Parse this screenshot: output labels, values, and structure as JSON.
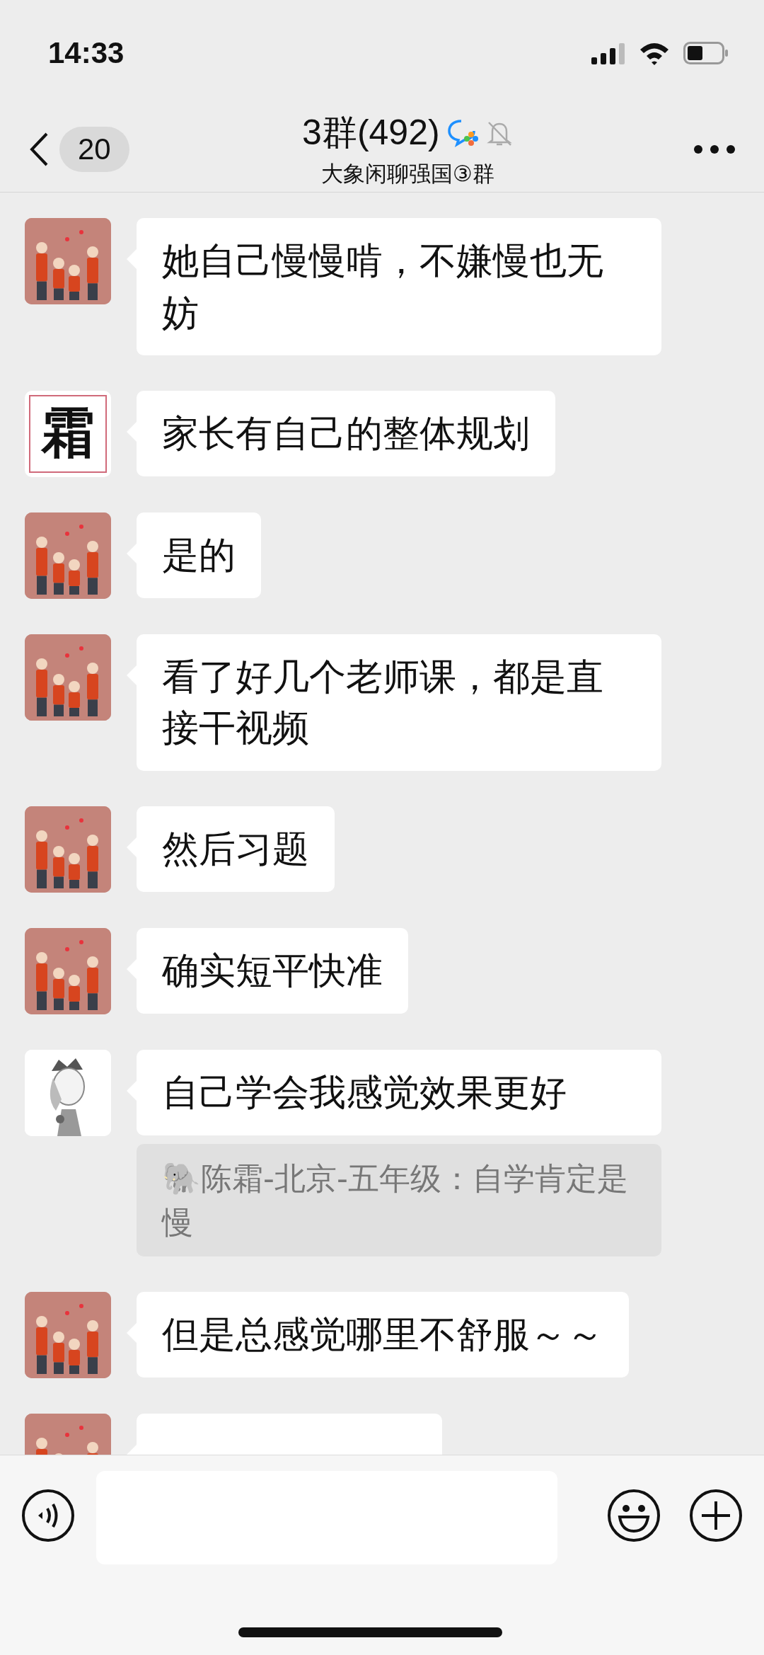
{
  "status_bar": {
    "time": "14:33"
  },
  "header": {
    "back_count": "20",
    "title": "3群(492)",
    "subtitle": "大象闲聊强国③群",
    "muted": true
  },
  "messages": [
    {
      "avatar": {
        "kind": "family"
      },
      "text": "她自己慢慢啃，不嫌慢也无妨"
    },
    {
      "avatar": {
        "kind": "glyph",
        "glyph": "霜"
      },
      "text": "家长有自己的整体规划"
    },
    {
      "avatar": {
        "kind": "family"
      },
      "text": "是的"
    },
    {
      "avatar": {
        "kind": "family"
      },
      "text": "看了好几个老师课，都是直接干视频"
    },
    {
      "avatar": {
        "kind": "family"
      },
      "text": "然后习题"
    },
    {
      "avatar": {
        "kind": "family"
      },
      "text": "确实短平快准"
    },
    {
      "avatar": {
        "kind": "portrait"
      },
      "text": "自己学会我感觉效果更好",
      "quote": "🐘陈霜-北京-五年级：自学肯定是慢"
    },
    {
      "avatar": {
        "kind": "family"
      },
      "text": "但是总感觉哪里不舒服～～"
    },
    {
      "avatar": {
        "kind": "family"
      }
    }
  ]
}
